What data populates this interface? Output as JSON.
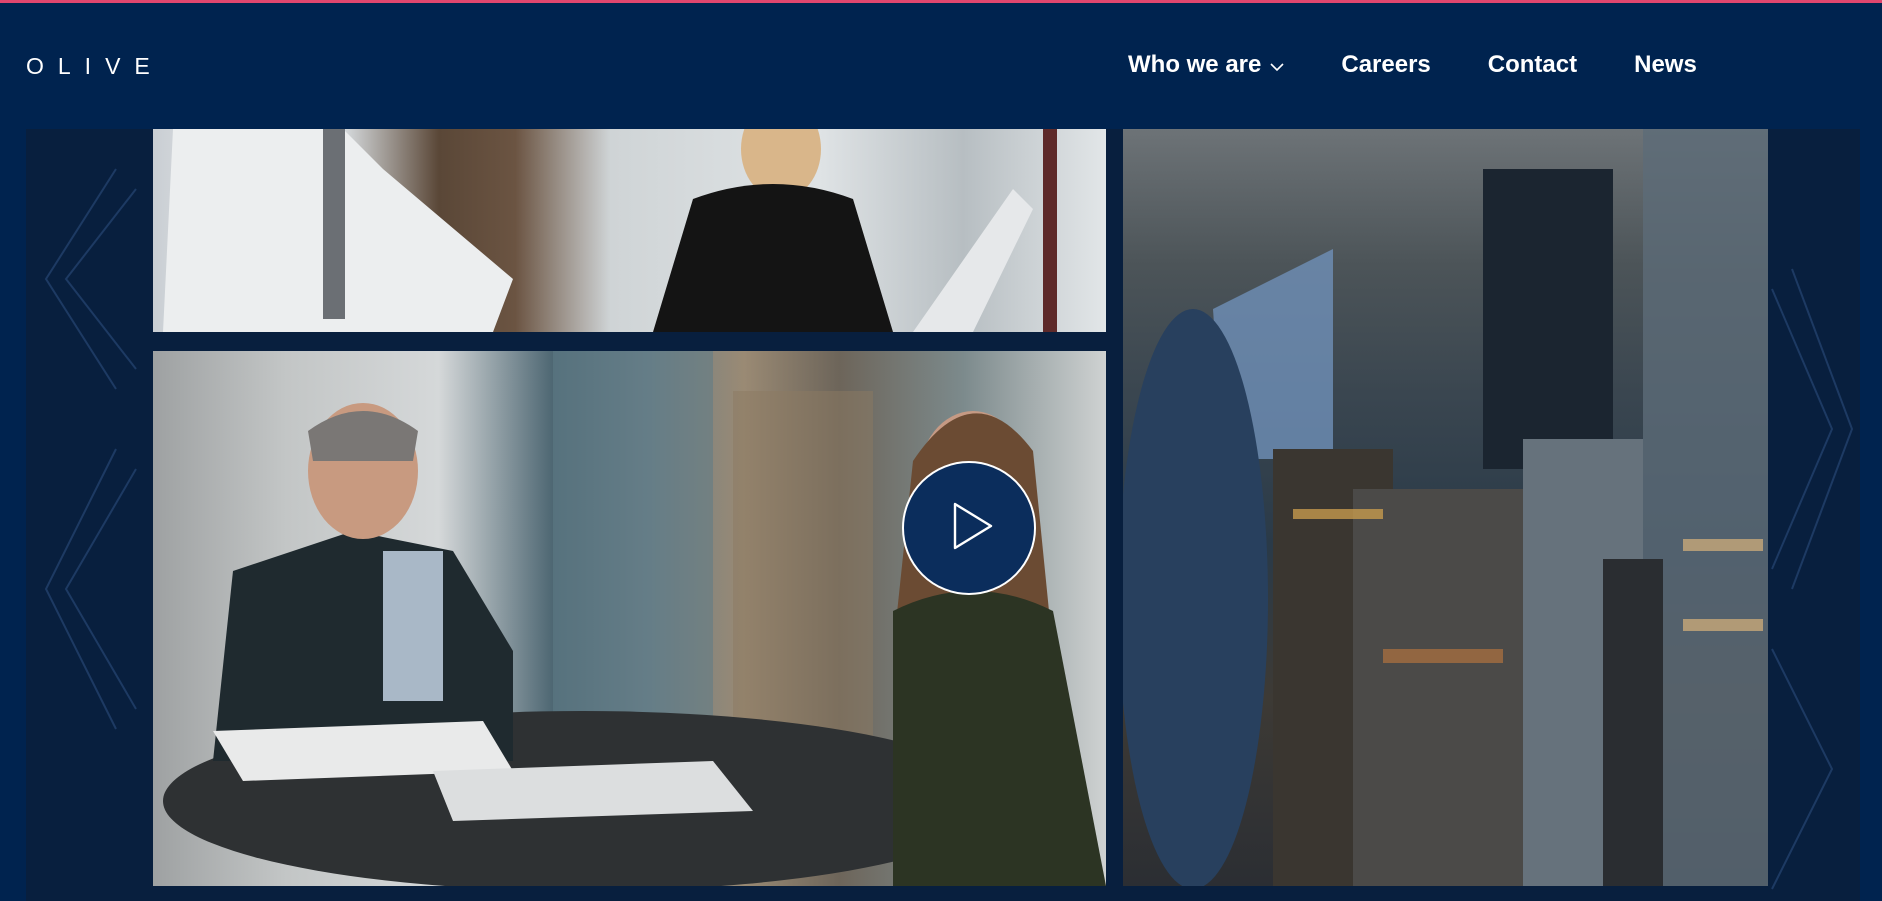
{
  "brand": {
    "logo_text": "OLIVE",
    "accent_color": "#e0466e",
    "navy": "#00234f"
  },
  "nav": {
    "items": [
      {
        "label": "Who we are",
        "has_dropdown": true
      },
      {
        "label": "Careers"
      },
      {
        "label": "Contact"
      },
      {
        "label": "News"
      }
    ]
  },
  "hero": {
    "play_icon": "play-icon",
    "tiles": [
      {
        "description_icon": "office-meeting-image"
      },
      {
        "description_icon": "desk-conversation-image"
      },
      {
        "description_icon": "london-skyline-image"
      }
    ]
  }
}
